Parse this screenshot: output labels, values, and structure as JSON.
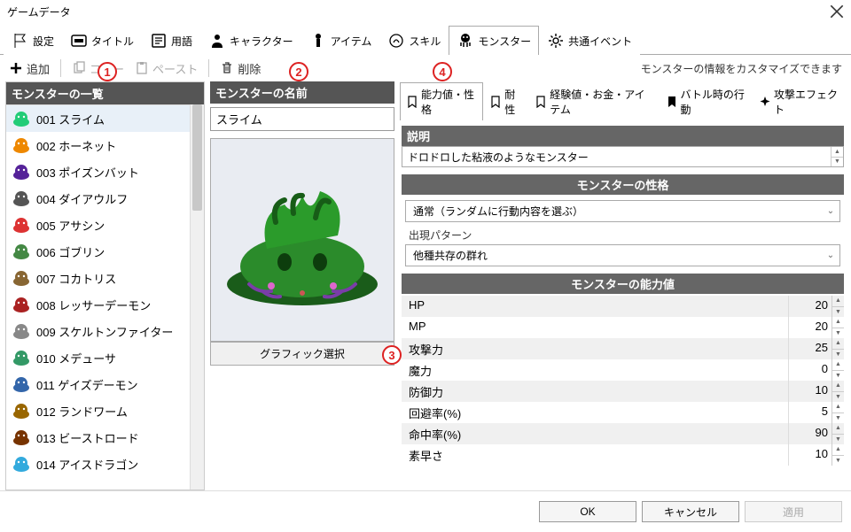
{
  "window": {
    "title": "ゲームデータ"
  },
  "main_tabs": [
    {
      "label": "設定"
    },
    {
      "label": "タイトル"
    },
    {
      "label": "用語"
    },
    {
      "label": "キャラクター"
    },
    {
      "label": "アイテム"
    },
    {
      "label": "スキル"
    },
    {
      "label": "モンスター"
    },
    {
      "label": "共通イベント"
    }
  ],
  "toolbar": {
    "add": "追加",
    "copy": "コピー",
    "paste": "ペースト",
    "delete": "削除",
    "hint": "モンスターの情報をカスタマイズできます"
  },
  "list_header": "モンスターの一覧",
  "monsters": [
    {
      "label": "001 スライム",
      "color": "#2c7"
    },
    {
      "label": "002 ホーネット",
      "color": "#e80"
    },
    {
      "label": "003 ポイズンバット",
      "color": "#529"
    },
    {
      "label": "004 ダイアウルフ",
      "color": "#555"
    },
    {
      "label": "005 アサシン",
      "color": "#d33"
    },
    {
      "label": "006 ゴブリン",
      "color": "#484"
    },
    {
      "label": "007 コカトリス",
      "color": "#863"
    },
    {
      "label": "008 レッサーデーモン",
      "color": "#a22"
    },
    {
      "label": "009 スケルトンファイター",
      "color": "#888"
    },
    {
      "label": "010 メデューサ",
      "color": "#396"
    },
    {
      "label": "011 ゲイズデーモン",
      "color": "#36a"
    },
    {
      "label": "012 ランドワーム",
      "color": "#960"
    },
    {
      "label": "013 ビーストロード",
      "color": "#730"
    },
    {
      "label": "014 アイスドラゴン",
      "color": "#3ad"
    }
  ],
  "name_pane": {
    "header": "モンスターの名前",
    "value": "スライム",
    "graphic_button": "グラフィック選択"
  },
  "detail_tabs": [
    {
      "label": "能力値・性格"
    },
    {
      "label": "耐性"
    },
    {
      "label": "経験値・お金・アイテム"
    },
    {
      "label": "バトル時の行動"
    },
    {
      "label": "攻撃エフェクト"
    }
  ],
  "desc": {
    "header": "説明",
    "value": "ドロドロした粘液のようなモンスター"
  },
  "personality": {
    "header": "モンスターの性格",
    "behavior": "通常（ランダムに行動内容を選ぶ）",
    "pattern_label": "出現パターン",
    "pattern_value": "他種共存の群れ"
  },
  "stats": {
    "header": "モンスターの能力値",
    "rows": [
      {
        "label": "HP",
        "value": "20"
      },
      {
        "label": "MP",
        "value": "20"
      },
      {
        "label": "攻撃力",
        "value": "25"
      },
      {
        "label": "魔力",
        "value": "0"
      },
      {
        "label": "防御力",
        "value": "10"
      },
      {
        "label": "回避率(%)",
        "value": "5"
      },
      {
        "label": "命中率(%)",
        "value": "90"
      },
      {
        "label": "素早さ",
        "value": "10"
      }
    ]
  },
  "footer": {
    "ok": "OK",
    "cancel": "キャンセル",
    "apply": "適用"
  },
  "badges": {
    "b1": "1",
    "b2": "2",
    "b3": "3",
    "b4": "4"
  }
}
